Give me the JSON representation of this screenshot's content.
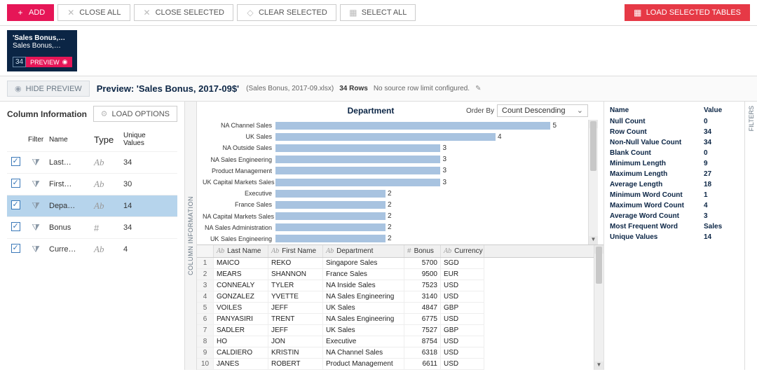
{
  "toolbar": {
    "add": "ADD",
    "close_all": "CLOSE ALL",
    "close_selected": "CLOSE SELECTED",
    "clear_selected": "CLEAR SELECTED",
    "select_all": "SELECT ALL",
    "load_selected": "LOAD SELECTED TABLES"
  },
  "card": {
    "line1": "'Sales Bonus,…",
    "line2": "Sales Bonus,…",
    "count": "34",
    "preview": "PREVIEW"
  },
  "previewbar": {
    "hide": "HIDE PREVIEW",
    "title": "Preview: 'Sales Bonus, 2017-09$'",
    "filename": "(Sales Bonus, 2017-09.xlsx)",
    "rows": "34 Rows",
    "limit": "No source row limit configured."
  },
  "colinfo": {
    "heading": "Column Information",
    "load_options": "LOAD OPTIONS",
    "head": {
      "filter": "Filter",
      "name": "Name",
      "type": "Type",
      "uv": "Unique Values"
    },
    "rows": [
      {
        "name": "Last…",
        "type": "Ab",
        "uv": "34",
        "sel": false
      },
      {
        "name": "First…",
        "type": "Ab",
        "uv": "30",
        "sel": false
      },
      {
        "name": "Depa…",
        "type": "Ab",
        "uv": "14",
        "sel": true
      },
      {
        "name": "Bonus",
        "type": "#",
        "uv": "34",
        "sel": false
      },
      {
        "name": "Curre…",
        "type": "Ab",
        "uv": "4",
        "sel": false
      }
    ]
  },
  "vtab_left": "COLUMN INFORMATION",
  "chart": {
    "title": "Department",
    "orderby_label": "Order By",
    "orderby_value": "Count Descending"
  },
  "chart_data": {
    "type": "bar",
    "orientation": "horizontal",
    "title": "Department",
    "xlabel": "",
    "ylabel": "",
    "xlim": [
      0,
      5
    ],
    "categories": [
      "NA Channel Sales",
      "UK Sales",
      "NA Outside Sales",
      "NA Sales Engineering",
      "Product Management",
      "UK Capital Markets Sales",
      "Executive",
      "France Sales",
      "NA Capital Markets Sales",
      "NA Sales Administration",
      "UK Sales Engineering"
    ],
    "values": [
      5,
      4,
      3,
      3,
      3,
      3,
      2,
      2,
      2,
      2,
      2
    ]
  },
  "grid": {
    "headers": {
      "c1": "Last Name",
      "c2": "First Name",
      "c3": "Department",
      "c4": "Bonus",
      "c5": "Currency"
    },
    "type_icons": {
      "ab": "Ab",
      "hash": "#"
    },
    "rows": [
      {
        "n": "1",
        "ln": "MAICO",
        "fn": "REKO",
        "dept": "Singapore Sales",
        "bonus": "5700",
        "cur": "SGD"
      },
      {
        "n": "2",
        "ln": "MEARS",
        "fn": "SHANNON",
        "dept": "France Sales",
        "bonus": "9500",
        "cur": "EUR"
      },
      {
        "n": "3",
        "ln": "CONNEALY",
        "fn": "TYLER",
        "dept": "NA Inside Sales",
        "bonus": "7523",
        "cur": "USD"
      },
      {
        "n": "4",
        "ln": "GONZALEZ",
        "fn": "YVETTE",
        "dept": "NA Sales Engineering",
        "bonus": "3140",
        "cur": "USD"
      },
      {
        "n": "5",
        "ln": "VOILES",
        "fn": "JEFF",
        "dept": "UK Sales",
        "bonus": "4847",
        "cur": "GBP"
      },
      {
        "n": "6",
        "ln": "PANYASIRI",
        "fn": "TRENT",
        "dept": "NA Sales Engineering",
        "bonus": "6775",
        "cur": "USD"
      },
      {
        "n": "7",
        "ln": "SADLER",
        "fn": "JEFF",
        "dept": "UK Sales",
        "bonus": "7527",
        "cur": "GBP"
      },
      {
        "n": "8",
        "ln": "HO",
        "fn": "JON",
        "dept": "Executive",
        "bonus": "8754",
        "cur": "USD"
      },
      {
        "n": "9",
        "ln": "CALDIERO",
        "fn": "KRISTIN",
        "dept": "NA Channel Sales",
        "bonus": "6318",
        "cur": "USD"
      },
      {
        "n": "10",
        "ln": "JANES",
        "fn": "ROBERT",
        "dept": "Product Management",
        "bonus": "6611",
        "cur": "USD"
      }
    ]
  },
  "stats": {
    "head_name": "Name",
    "head_value": "Value",
    "rows": [
      {
        "k": "Null Count",
        "v": "0"
      },
      {
        "k": "Row Count",
        "v": "34"
      },
      {
        "k": "Non-Null Value Count",
        "v": "34"
      },
      {
        "k": "Blank Count",
        "v": "0"
      },
      {
        "k": "Minimum Length",
        "v": "9"
      },
      {
        "k": "Maximum Length",
        "v": "27"
      },
      {
        "k": "Average Length",
        "v": "18"
      },
      {
        "k": "Minimum Word Count",
        "v": "1"
      },
      {
        "k": "Maximum Word Count",
        "v": "4"
      },
      {
        "k": "Average Word Count",
        "v": "3"
      },
      {
        "k": "Most Frequent Word",
        "v": "Sales"
      },
      {
        "k": "Unique Values",
        "v": "14"
      }
    ]
  },
  "filters_tab": "FILTERS"
}
